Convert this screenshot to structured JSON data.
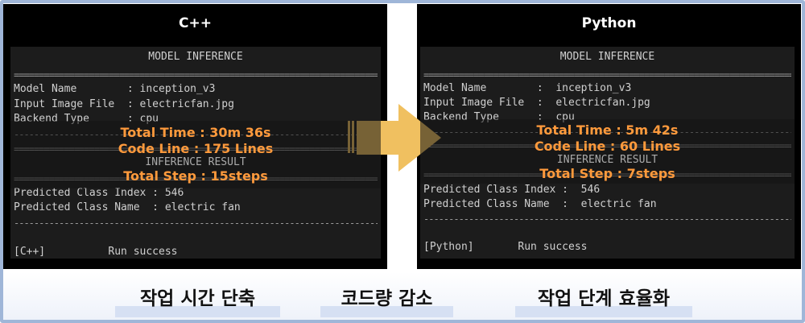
{
  "left": {
    "title": "C++",
    "terminal": {
      "header": "MODEL INFERENCE",
      "lines": [
        "Model Name        : inception_v3",
        "Input Image File  : electricfan.jpg",
        "Backend Type      : cpu"
      ],
      "result_header": "INFERENCE RESULT",
      "results": [
        "Predicted Class Index : 546",
        "Predicted Class Name  : electric fan"
      ],
      "status": "[C++]          Run success"
    },
    "overlay": [
      "Total Time : 30m 36s",
      "Code Line : 175 Lines",
      "Total Step : 15steps"
    ]
  },
  "right": {
    "title": "Python",
    "terminal": {
      "header": "MODEL INFERENCE",
      "lines": [
        "Model Name        :  inception_v3",
        "Input Image File  :  electricfan.jpg",
        "Backend Type      :  cpu"
      ],
      "result_header": "INFERENCE RESULT",
      "results": [
        "Predicted Class Index :  546",
        "Predicted Class Name  :  electric fan"
      ],
      "status": "[Python]       Run success"
    },
    "overlay": [
      "Total Time : 5m 42s",
      "Code Line : 60 Lines",
      "Total Step : 7steps"
    ]
  },
  "captions": [
    "작업 시간 단축",
    "코드량 감소",
    "작업 단계 효율화"
  ],
  "colors": {
    "highlight": "#ff9a3c",
    "arrow": "#f0c060"
  },
  "icons": {
    "arrow": "right-arrow-icon"
  }
}
